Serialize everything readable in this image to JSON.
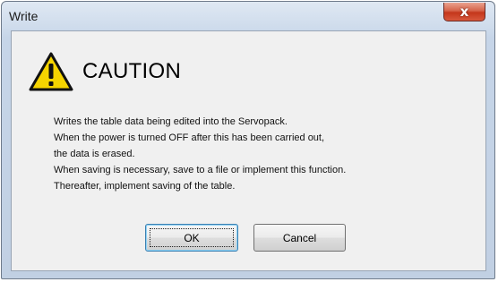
{
  "window": {
    "title": "Write",
    "close_label": "x"
  },
  "caution": {
    "icon": "warning-triangle-icon",
    "heading": "CAUTION"
  },
  "message": {
    "lines": [
      "Writes the table data being edited into the Servopack.",
      "When the power is turned OFF after this has been carried out,",
      "the data is erased.",
      "When saving is necessary, save to a file or implement this function.",
      "Thereafter, implement saving of the table."
    ]
  },
  "buttons": {
    "ok_label": "OK",
    "cancel_label": "Cancel"
  },
  "colors": {
    "warning_fill": "#f5d400",
    "close_button": "#c4361b",
    "default_button_border": "#3c7fb1"
  }
}
